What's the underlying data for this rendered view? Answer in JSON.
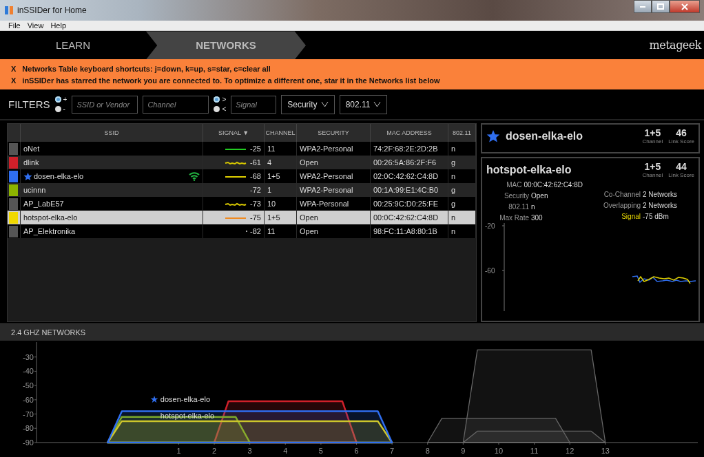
{
  "window": {
    "title": "inSSIDer for Home"
  },
  "menu": [
    "File",
    "View",
    "Help"
  ],
  "nav": {
    "tabs": [
      {
        "label": "LEARN",
        "selected": false
      },
      {
        "label": "NETWORKS",
        "selected": true
      }
    ],
    "logo": "metageek"
  },
  "banners": [
    {
      "close": "X",
      "text": "Networks Table keyboard shortcuts: j=down, k=up, s=star, c=clear all"
    },
    {
      "close": "X",
      "text": "inSSIDer has starred the network you are connected to. To optimize a different one, star it in the Networks list below"
    }
  ],
  "filters": {
    "label": "FILTERS",
    "include": [
      {
        "label": "+",
        "selected": true
      },
      {
        "label": "-",
        "selected": false
      }
    ],
    "ssid": {
      "placeholder": "SSID or Vendor"
    },
    "channel": {
      "placeholder": "Channel"
    },
    "signal_compare": [
      {
        "label": ">",
        "selected": true
      },
      {
        "label": "<",
        "selected": false
      }
    ],
    "signal": {
      "placeholder": "Signal"
    },
    "dropdowns": [
      "Security",
      "802.11"
    ]
  },
  "table": {
    "columns": [
      {
        "label": "SSID"
      },
      {
        "label": "SIGNAL",
        "sort_mark": "▼"
      },
      {
        "label": "CHANNEL"
      },
      {
        "label": "SECURITY"
      },
      {
        "label": "MAC ADDRESS"
      },
      {
        "label": "802.11"
      }
    ],
    "rows": [
      {
        "color": "#555555",
        "ssid": "oNet",
        "starred": false,
        "connected": false,
        "selected": false,
        "trend": {
          "kind": "flat",
          "color": "#22cc22"
        },
        "signal": "-25",
        "channel": "11",
        "security": "WPA2-Personal",
        "mac": "74:2F:68:2E:2D:2B",
        "mode": "n"
      },
      {
        "color": "#d0202a",
        "ssid": "dlink",
        "starred": false,
        "connected": false,
        "selected": false,
        "trend": {
          "kind": "wavy",
          "color": "#d8c800"
        },
        "signal": "-61",
        "channel": "4",
        "security": "Open",
        "mac": "00:26:5A:86:2F:F6",
        "mode": "g"
      },
      {
        "color": "#2f6ef0",
        "ssid": "dosen-elka-elo",
        "starred": true,
        "connected": true,
        "selected": false,
        "trend": {
          "kind": "flat",
          "color": "#e0d000"
        },
        "signal": "-68",
        "channel": "1+5",
        "security": "WPA2-Personal",
        "mac": "02:0C:42:62:C4:8D",
        "mode": "n"
      },
      {
        "color": "#8cb400",
        "ssid": "ucinnn",
        "starred": false,
        "connected": false,
        "selected": false,
        "signal": "-72",
        "channel": "1",
        "security": "WPA2-Personal",
        "mac": "00:1A:99:E1:4C:B0",
        "mode": "g"
      },
      {
        "color": "#555555",
        "ssid": "AP_LabE57",
        "starred": false,
        "connected": false,
        "selected": false,
        "trend": {
          "kind": "wavy",
          "color": "#d8c800"
        },
        "signal": "-73",
        "channel": "10",
        "security": "WPA-Personal",
        "mac": "00:25:9C:D0:25:FE",
        "mode": "g"
      },
      {
        "color": "#f0d800",
        "ssid": "hotspot-elka-elo",
        "starred": false,
        "connected": false,
        "selected": true,
        "trend": {
          "kind": "flat",
          "color": "#f08a20"
        },
        "signal": "-75",
        "channel": "1+5",
        "security": "Open",
        "mac": "00:0C:42:62:C4:8D",
        "mode": "n"
      },
      {
        "color": "#555555",
        "ssid": "AP_Elektronika",
        "starred": false,
        "connected": false,
        "selected": false,
        "trend": {
          "kind": "dot",
          "color": "#aaaaaa"
        },
        "signal": "-82",
        "channel": "11",
        "security": "Open",
        "mac": "98:FC:11:A8:80:1B",
        "mode": "n"
      }
    ]
  },
  "starred_card": {
    "ssid": "dosen-elka-elo",
    "starred": true,
    "channel": "1+5",
    "channel_label": "Channel",
    "link_score": "46",
    "link_score_label": "Link Score"
  },
  "selected_card": {
    "ssid": "hotspot-elka-elo",
    "channel": "1+5",
    "channel_label": "Channel",
    "link_score": "44",
    "link_score_label": "Link Score",
    "fields_left": [
      {
        "label": "MAC",
        "value": "00:0C:42:62:C4:8D"
      },
      {
        "label": "Security",
        "value": "Open"
      },
      {
        "label": "802.11",
        "value": "n"
      },
      {
        "label": "Max Rate",
        "value": "300"
      }
    ],
    "fields_right": [
      {
        "label": "Co-Channel",
        "value": "2 Networks",
        "highlight": false
      },
      {
        "label": "Overlapping",
        "value": "2 Networks",
        "highlight": false
      },
      {
        "label": "Signal",
        "value": "-75 dBm",
        "highlight": true
      }
    ],
    "history": {
      "axis_labels": [
        "-20",
        "-60"
      ]
    }
  },
  "spectrum": {
    "title": "2.4 GHZ NETWORKS",
    "chart_data": {
      "type": "area",
      "x": [
        -1,
        -0.6,
        2,
        2.4,
        2.6,
        3,
        5.6,
        6,
        6.6,
        7,
        8,
        8.4,
        9,
        9.4,
        11.6,
        12,
        12.6,
        13
      ],
      "xlim": [
        -3,
        15.6
      ],
      "ylim": [
        -90,
        -20
      ],
      "xticks": [
        1,
        2,
        3,
        4,
        5,
        6,
        7,
        8,
        9,
        10,
        11,
        12,
        13
      ],
      "yticks": [
        -30,
        -40,
        -50,
        -60,
        -70,
        -80,
        -90
      ],
      "series": [
        {
          "color": "#666666",
          "values": [
            null,
            null,
            null,
            null,
            null,
            null,
            null,
            null,
            null,
            null,
            null,
            null,
            -90,
            -25,
            -25,
            -25,
            -25,
            -90
          ]
        },
        {
          "color": "#666666",
          "values": [
            null,
            null,
            null,
            null,
            null,
            null,
            null,
            null,
            null,
            null,
            -90,
            -73,
            -73,
            -73,
            -73,
            -90,
            null,
            null
          ]
        },
        {
          "color": "#666666",
          "values": [
            null,
            null,
            null,
            null,
            null,
            null,
            null,
            null,
            null,
            null,
            null,
            null,
            -90,
            -82,
            -82,
            -82,
            -82,
            -90
          ]
        },
        {
          "color": "#d0202a",
          "values": [
            null,
            null,
            -90,
            -61,
            -61,
            -61,
            -61,
            -90,
            null,
            null,
            null,
            null,
            null,
            null,
            null,
            null,
            null,
            null
          ]
        },
        {
          "color": "#8cb400",
          "values": [
            -90,
            -72,
            -72,
            -72,
            -72,
            -90,
            null,
            null,
            null,
            null,
            null,
            null,
            null,
            null,
            null,
            null,
            null,
            null
          ]
        },
        {
          "name": "hotspot-elka-elo",
          "color": "#f0d800",
          "values": [
            -90,
            -75,
            -75,
            -75,
            -75,
            -75,
            -75,
            -75,
            -75,
            -90,
            null,
            null,
            null,
            null,
            null,
            null,
            null,
            null
          ]
        },
        {
          "name": "dosen-elka-elo",
          "color": "#2f6ef0",
          "values": [
            -90,
            -68,
            -68,
            -68,
            -68,
            -68,
            -68,
            -68,
            -68,
            -90,
            null,
            null,
            null,
            null,
            null,
            null,
            null,
            null
          ]
        }
      ],
      "annotations": [
        "★"
      ]
    }
  }
}
